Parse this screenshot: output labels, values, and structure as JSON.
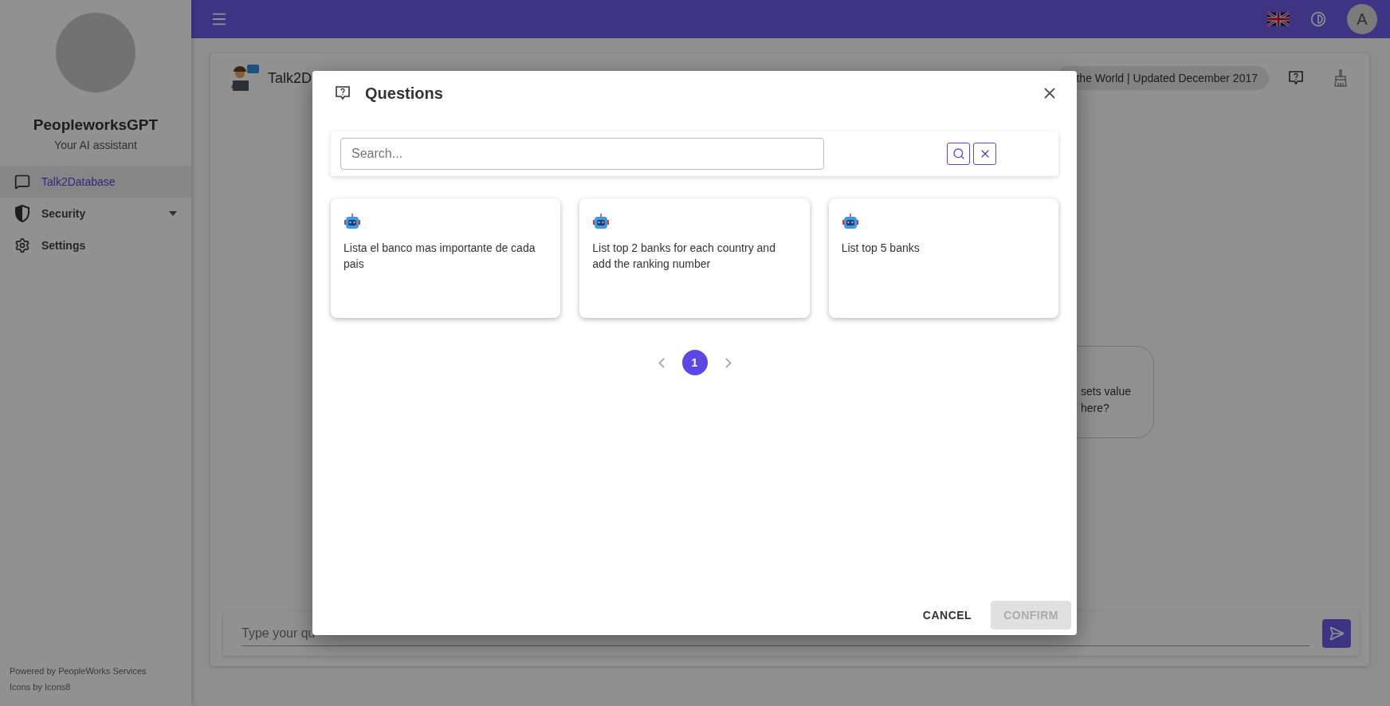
{
  "app_bar": {
    "avatar_letter": "A"
  },
  "sidebar": {
    "brand": "PeopleworksGPT",
    "tagline": "Your AI assistant",
    "items": [
      {
        "label": "Talk2Database",
        "selected": true,
        "kind": "link"
      },
      {
        "label": "Security",
        "selected": false,
        "kind": "group",
        "expanded": false
      },
      {
        "label": "Settings",
        "selected": false,
        "kind": "link"
      }
    ],
    "footer": [
      "Powered by PeopleWorks Services",
      "Icons by Icons8"
    ]
  },
  "page": {
    "title": "Talk2D",
    "dataset_chip": "the World | Updated December 2017",
    "message_lines": [
      "sets value",
      "here?"
    ],
    "input_placeholder": "Type your qu"
  },
  "dialog": {
    "title": "Questions",
    "search_placeholder": "Search...",
    "questions": [
      "Lista el banco mas importante de cada pais",
      "List top 2 banks for each country and add the ranking number",
      "List top 5 banks"
    ],
    "pages": [
      {
        "label": "1",
        "selected": true
      }
    ],
    "buttons": [
      {
        "label": "CANCEL",
        "disabled": false
      },
      {
        "label": "CONFIRM",
        "disabled": true
      }
    ]
  }
}
